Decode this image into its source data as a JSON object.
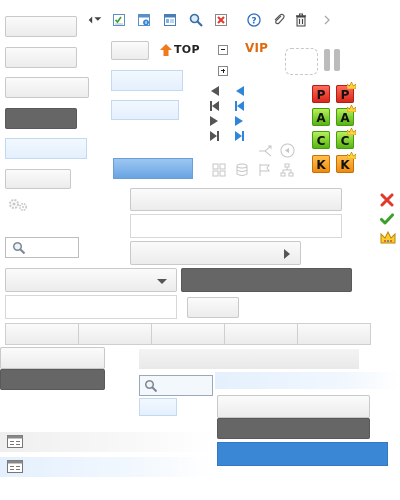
{
  "toolbar": {
    "top_link": "TOP",
    "vip_label": "VIP",
    "icons": [
      "back-forward-icon",
      "checklist-icon",
      "calendar-upload-icon",
      "window-icon",
      "search-icon",
      "close-box-icon",
      "help-icon",
      "attachment-icon",
      "trash-icon",
      "chevron-right-icon"
    ]
  },
  "badges": {
    "letters": [
      "P",
      "P",
      "A",
      "A",
      "C",
      "C",
      "K",
      "K"
    ]
  },
  "colors": {
    "dark_button": "#666666",
    "accent_blue": "#3a87d6",
    "light_blue_field": "#e4f0fd",
    "vip_orange": "#e06a12",
    "badge_red": "#d9261a",
    "badge_green": "#55b512",
    "badge_orange": "#ee8a10"
  }
}
